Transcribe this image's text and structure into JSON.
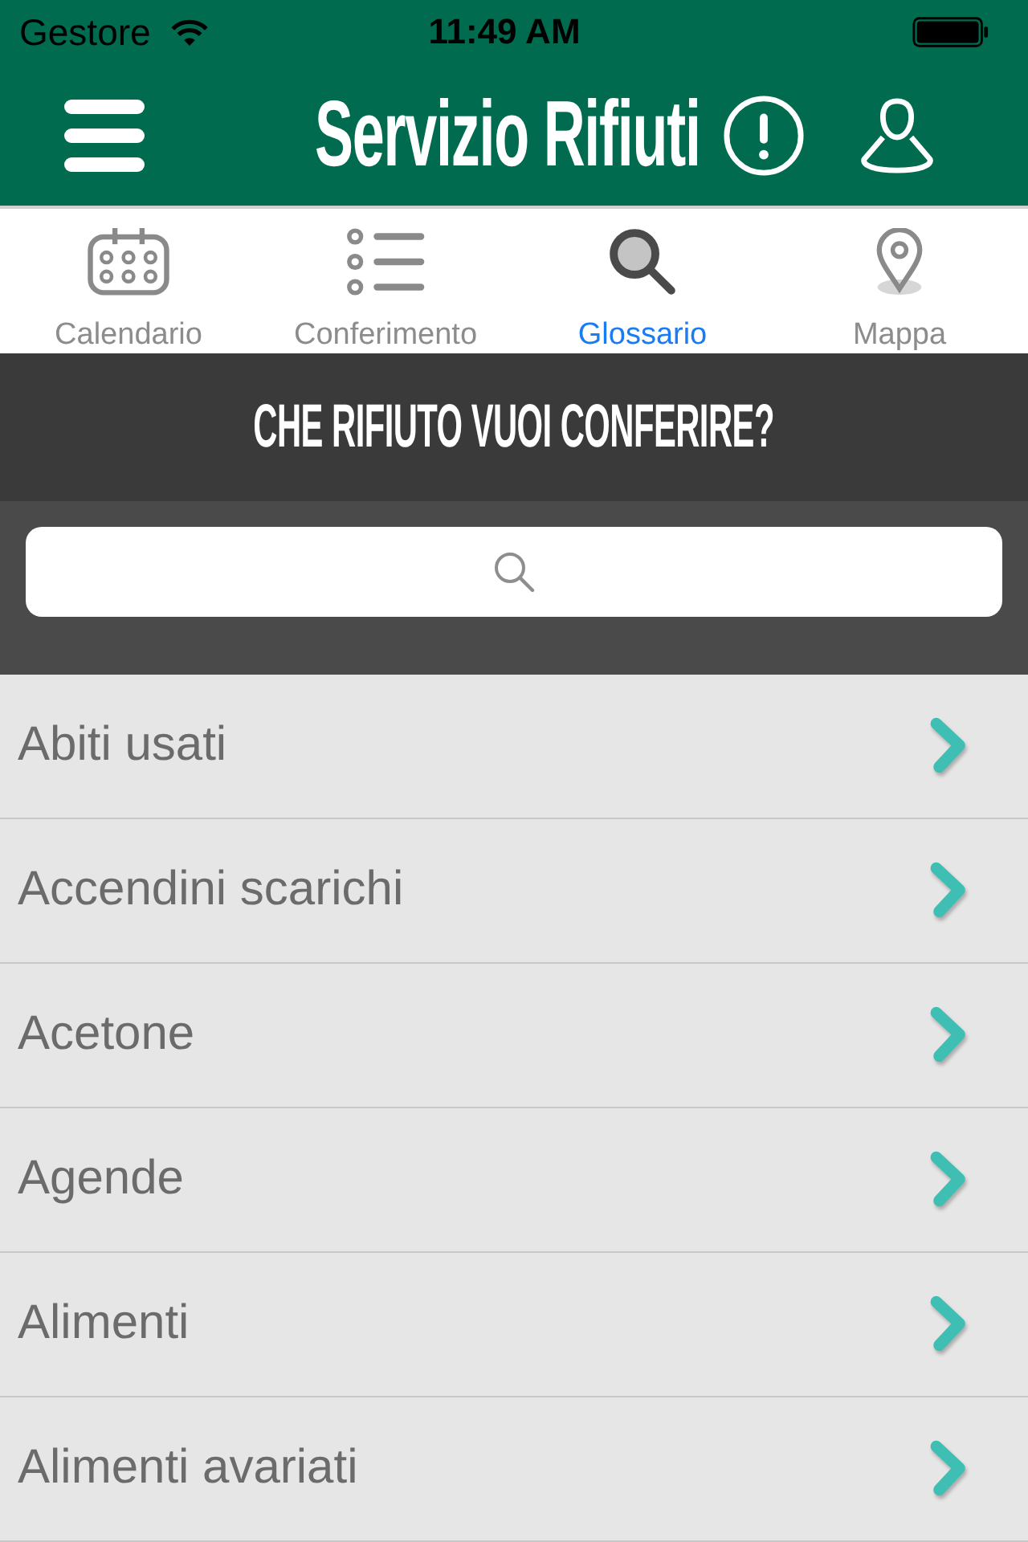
{
  "status_bar": {
    "carrier": "Gestore",
    "time": "11:49 AM"
  },
  "header": {
    "title": "Servizio Rifiuti"
  },
  "tabs": [
    {
      "label": "Calendario",
      "kind": "calendar",
      "selected": false
    },
    {
      "label": "Conferimento",
      "kind": "list",
      "selected": false
    },
    {
      "label": "Glossario",
      "kind": "search",
      "selected": true
    },
    {
      "label": "Mappa",
      "kind": "pin",
      "selected": false
    }
  ],
  "banner": {
    "title": "CHE RIFIUTO VUOI CONFERIRE?"
  },
  "items": [
    {
      "label": "Abiti usati"
    },
    {
      "label": "Accendini scarichi"
    },
    {
      "label": "Acetone"
    },
    {
      "label": "Agende"
    },
    {
      "label": "Alimenti"
    },
    {
      "label": "Alimenti avariati"
    }
  ]
}
